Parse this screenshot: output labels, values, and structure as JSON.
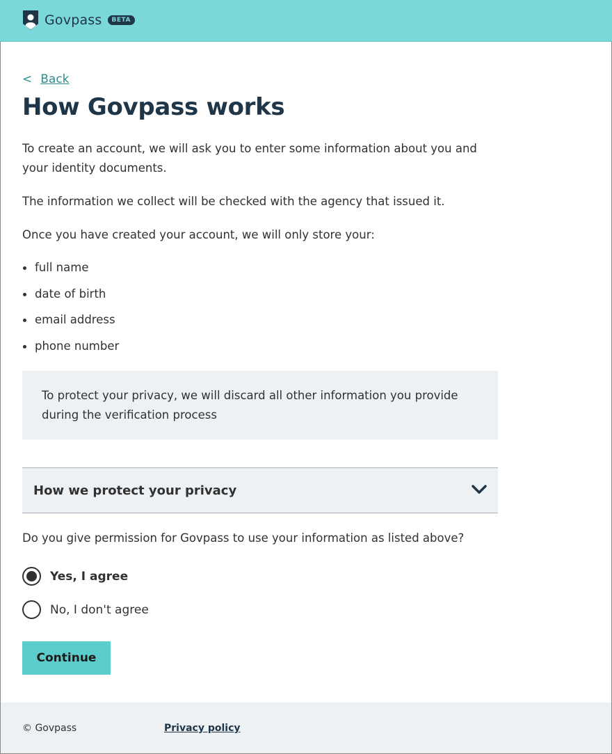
{
  "header": {
    "brand": "Govpass",
    "badge": "BETA",
    "colors": {
      "background": "#7ad8d8",
      "brand_text": "#1f3548"
    }
  },
  "back_link": {
    "chevron": "<",
    "label": "Back"
  },
  "page_title": "How Govpass works",
  "intro": {
    "p1": "To create an account, we will ask you to enter some information about you and your identity documents.",
    "p2": "The information we collect will be checked with the agency that issued it.",
    "p3": "Once you have created your account, we will only store your:"
  },
  "stored_items": [
    "full name",
    "date of birth",
    "email address",
    "phone number"
  ],
  "callout": "To protect your privacy, we will discard all other information you provide during the verification process",
  "accordion": {
    "title": "How we protect your privacy",
    "icon": "chevron-down-icon",
    "expanded": false
  },
  "consent": {
    "question": "Do you give permission for Govpass to use your information as listed above?",
    "options": [
      {
        "label": "Yes, I agree",
        "selected": true
      },
      {
        "label": "No, I don't agree",
        "selected": false
      }
    ]
  },
  "continue_label": "Continue",
  "footer": {
    "copyright": "© Govpass",
    "privacy_label": "Privacy policy"
  },
  "colors": {
    "accent": "#5ccdcd",
    "link": "#2f8c8c",
    "heading": "#1f3548",
    "panel": "#eef1f4"
  }
}
